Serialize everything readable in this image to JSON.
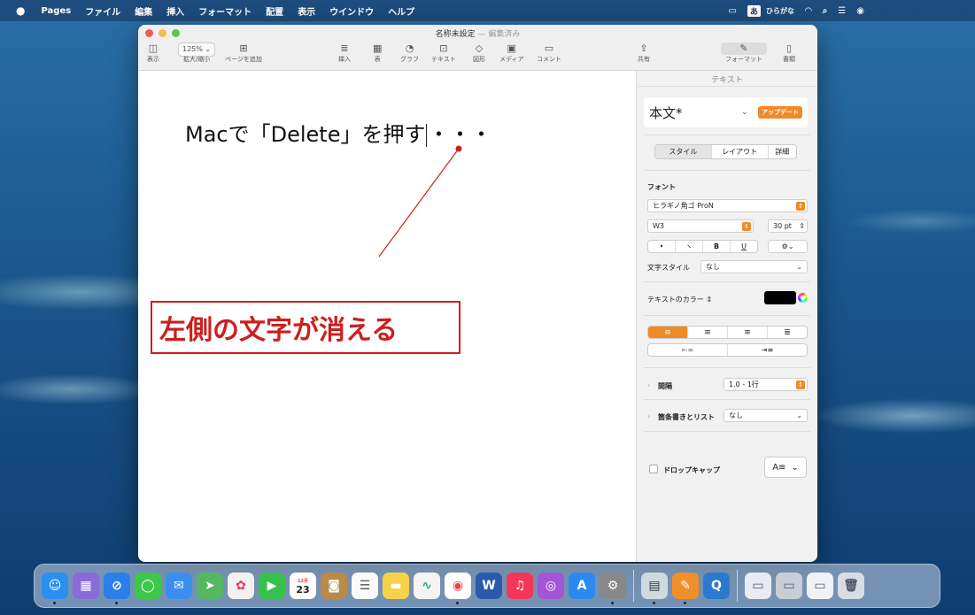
{
  "menubar": {
    "apple_icon": "apple-icon",
    "items": [
      "Pages",
      "ファイル",
      "編集",
      "挿入",
      "フォーマット",
      "配置",
      "表示",
      "ウインドウ",
      "ヘルプ"
    ],
    "ime_label": "あ",
    "ime_text": "ひらがな"
  },
  "window": {
    "title": "名称未設定",
    "title_separator": "—",
    "title_status": "編集済み",
    "toolbar": {
      "view": "表示",
      "zoom_value": "125%",
      "zoom_label": "拡大/縮小",
      "add_page": "ページを追加",
      "insert": "挿入",
      "table": "表",
      "chart": "グラフ",
      "text": "テキスト",
      "shape": "図形",
      "media": "メディア",
      "comment": "コメント",
      "share": "共有",
      "format": "フォーマット",
      "document": "書類"
    }
  },
  "document": {
    "text_before_caret": "Macで「Delete」を押す",
    "text_after_caret": "・・・",
    "annotation": "左側の文字が消える",
    "annotation_color": "#cc1f1f"
  },
  "inspector": {
    "tab_label": "テキスト",
    "paragraph_style": "本文*",
    "update_button": "アップデート",
    "segments": [
      "スタイル",
      "レイアウト",
      "詳細"
    ],
    "font_section": "フォント",
    "font_family": "ヒラギノ角ゴ ProN",
    "font_weight": "W3",
    "font_size": "30 pt",
    "bullet_btn": "•",
    "mark_btn": "ヽ",
    "bold_btn": "B",
    "underline_btn": "U",
    "char_style_label": "文字スタイル",
    "char_style_value": "なし",
    "text_color_label": "テキストのカラー",
    "text_color": "#000000",
    "spacing_label": "間隔",
    "spacing_value": "1.0 - 1行",
    "bullets_label": "箇条書きとリスト",
    "bullets_value": "なし",
    "dropcap_label": "ドロップキャップ",
    "accent_color": "#f08a28"
  },
  "dock": {
    "calendar_month": "12月",
    "calendar_day": "23"
  }
}
